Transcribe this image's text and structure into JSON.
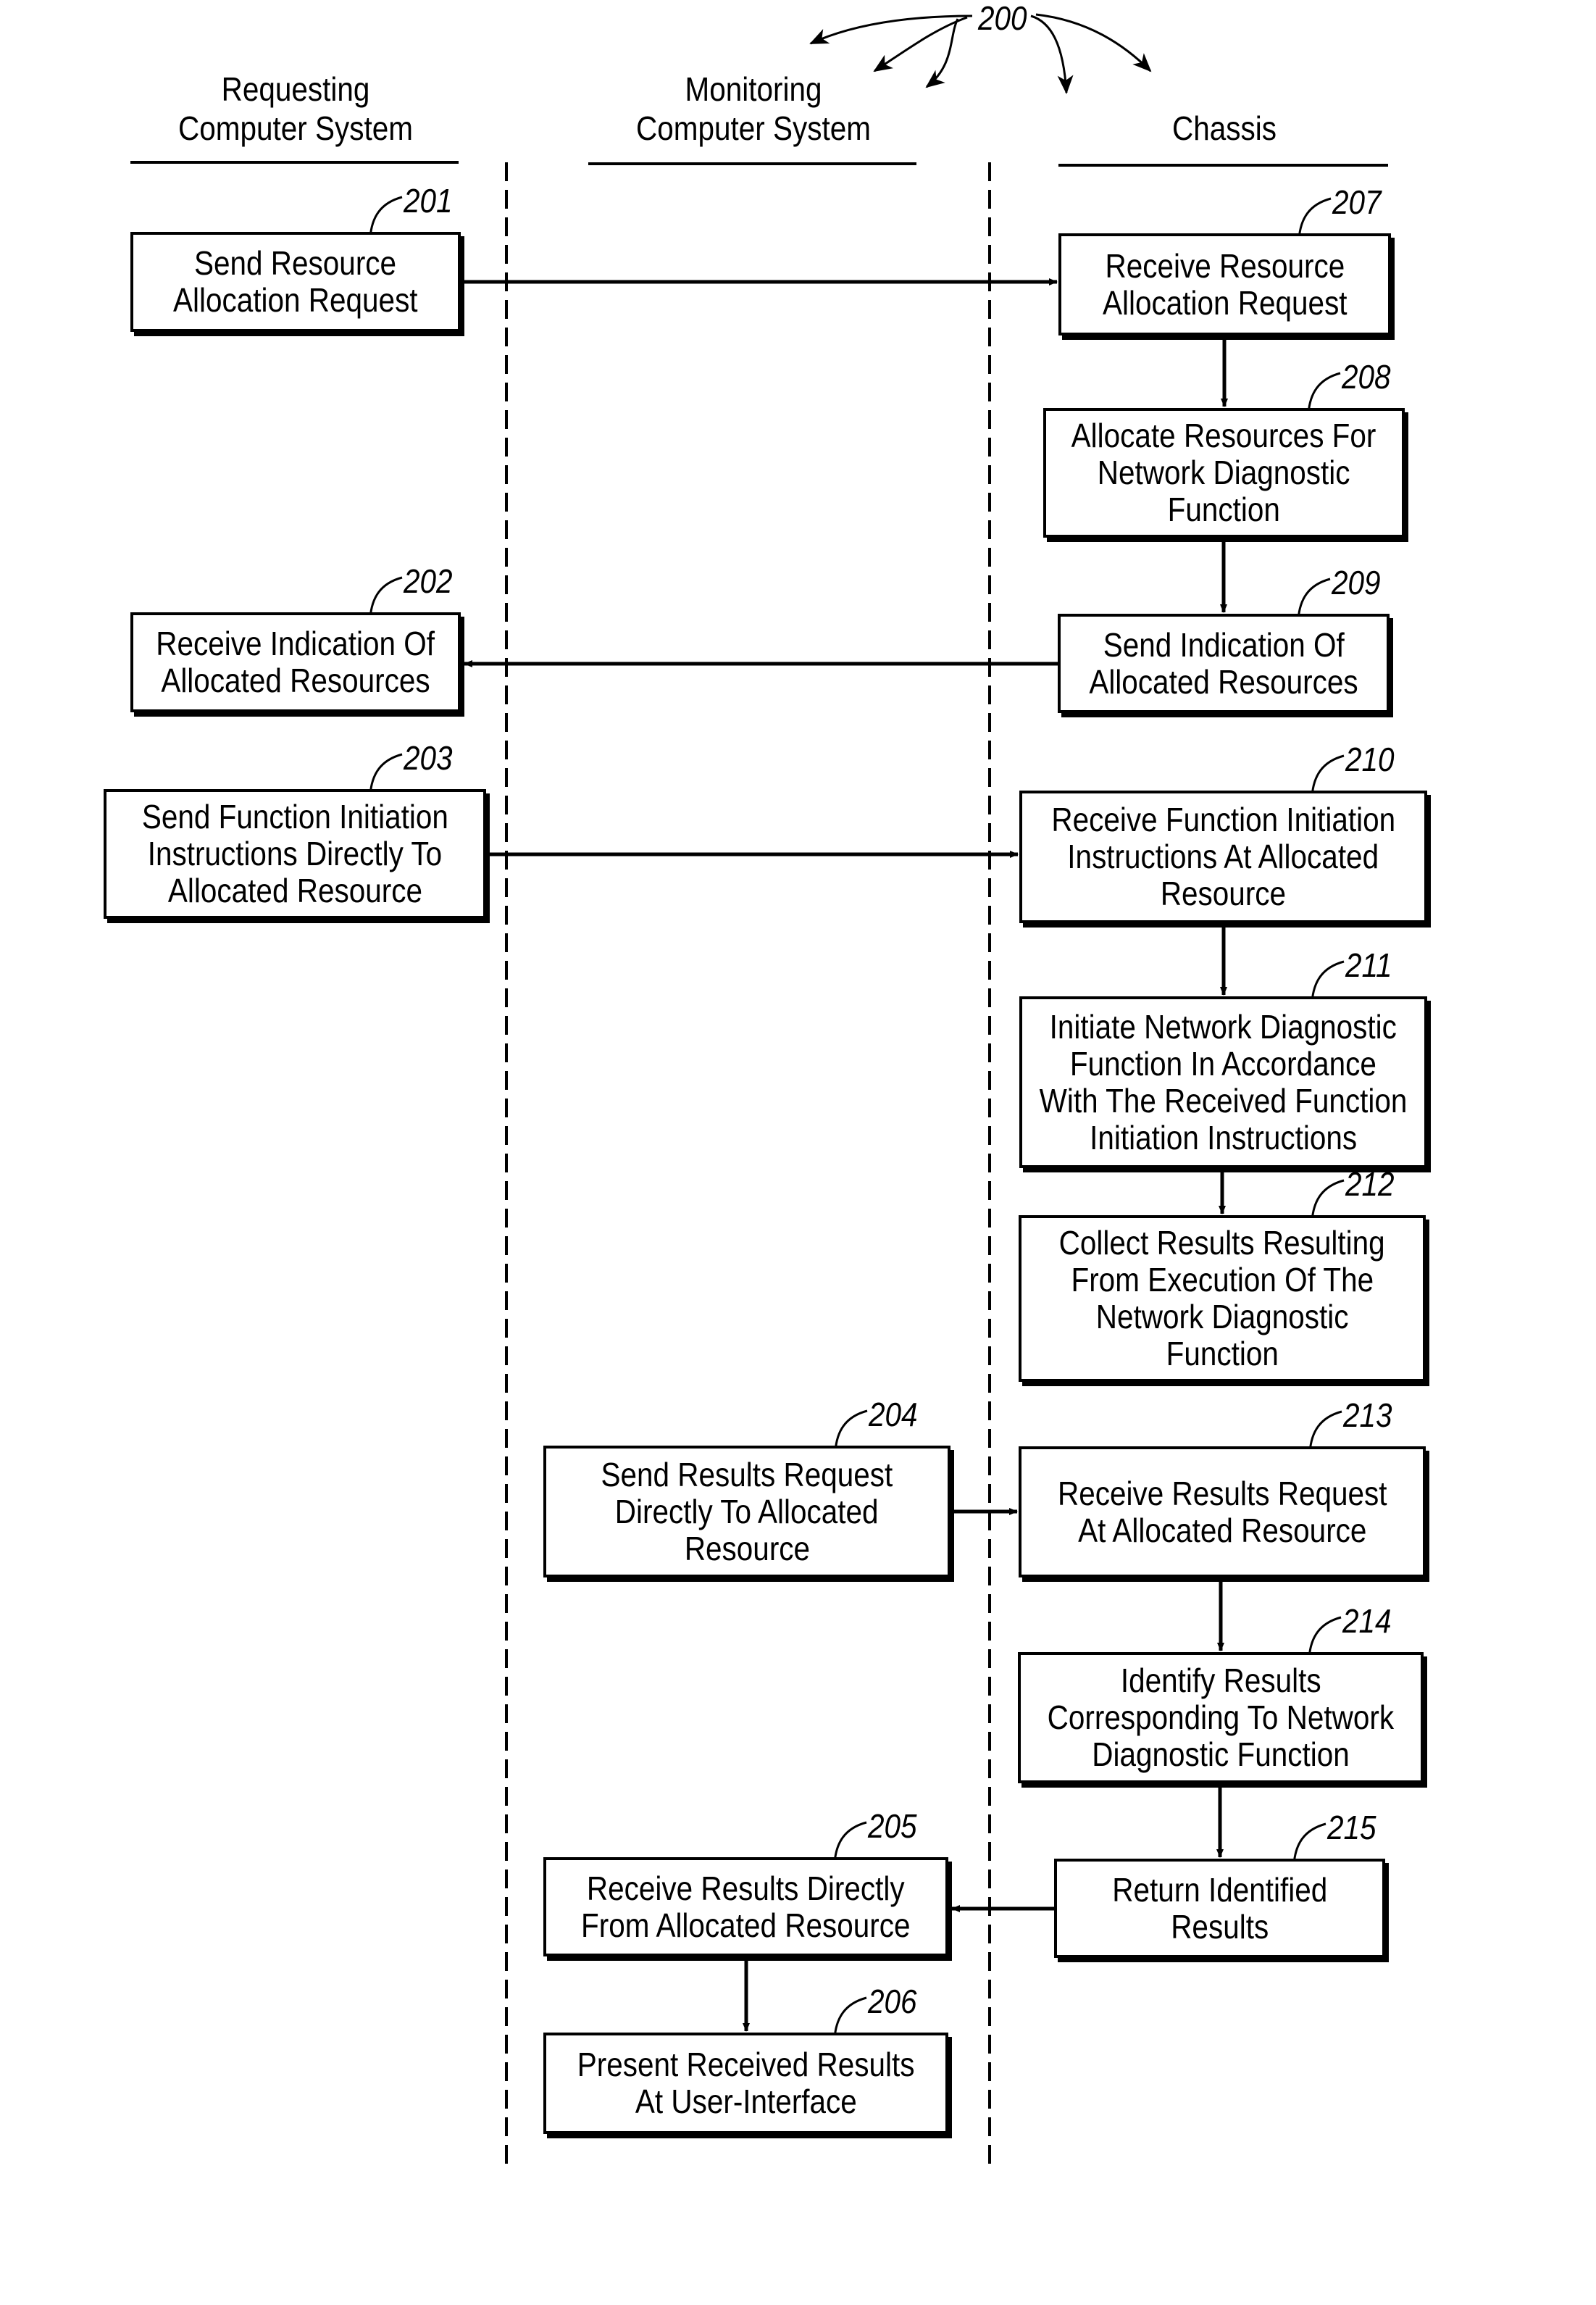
{
  "figure": {
    "reference": "200",
    "lanes": [
      {
        "id": "requesting",
        "title_lines": [
          "Requesting",
          "Computer System"
        ]
      },
      {
        "id": "monitoring",
        "title_lines": [
          "Monitoring",
          "Computer System"
        ]
      },
      {
        "id": "chassis",
        "title_lines": [
          "Chassis"
        ]
      }
    ],
    "steps": [
      {
        "ref": "201",
        "lane": "requesting",
        "lines": [
          "Send Resource",
          "Allocation Request"
        ]
      },
      {
        "ref": "202",
        "lane": "requesting",
        "lines": [
          "Receive Indication Of",
          "Allocated Resources"
        ]
      },
      {
        "ref": "203",
        "lane": "requesting",
        "lines": [
          "Send Function Initiation",
          "Instructions Directly To",
          "Allocated Resource"
        ]
      },
      {
        "ref": "204",
        "lane": "monitoring",
        "lines": [
          "Send Results Request",
          "Directly To Allocated",
          "Resource"
        ]
      },
      {
        "ref": "205",
        "lane": "monitoring",
        "lines": [
          "Receive Results Directly",
          "From Allocated Resource"
        ]
      },
      {
        "ref": "206",
        "lane": "monitoring",
        "lines": [
          "Present Received Results",
          "At User-Interface"
        ]
      },
      {
        "ref": "207",
        "lane": "chassis",
        "lines": [
          "Receive Resource",
          "Allocation Request"
        ]
      },
      {
        "ref": "208",
        "lane": "chassis",
        "lines": [
          "Allocate Resources For",
          "Network Diagnostic",
          "Function"
        ]
      },
      {
        "ref": "209",
        "lane": "chassis",
        "lines": [
          "Send Indication Of",
          "Allocated Resources"
        ]
      },
      {
        "ref": "210",
        "lane": "chassis",
        "lines": [
          "Receive Function Initiation",
          "Instructions At Allocated",
          "Resource"
        ]
      },
      {
        "ref": "211",
        "lane": "chassis",
        "lines": [
          "Initiate Network Diagnostic",
          "Function In Accordance",
          "With The Received Function",
          "Initiation Instructions"
        ]
      },
      {
        "ref": "212",
        "lane": "chassis",
        "lines": [
          "Collect Results Resulting",
          "From Execution Of The",
          "Network Diagnostic",
          "Function"
        ]
      },
      {
        "ref": "213",
        "lane": "chassis",
        "lines": [
          "Receive Results Request",
          "At Allocated Resource"
        ]
      },
      {
        "ref": "214",
        "lane": "chassis",
        "lines": [
          "Identify Results",
          "Corresponding To Network",
          "Diagnostic Function"
        ]
      },
      {
        "ref": "215",
        "lane": "chassis",
        "lines": [
          "Return Identified",
          "Results"
        ]
      }
    ],
    "flows": [
      {
        "from": "201",
        "to": "207",
        "direction": "right"
      },
      {
        "from": "207",
        "to": "208",
        "direction": "down"
      },
      {
        "from": "208",
        "to": "209",
        "direction": "down"
      },
      {
        "from": "209",
        "to": "202",
        "direction": "left"
      },
      {
        "from": "203",
        "to": "210",
        "direction": "right"
      },
      {
        "from": "210",
        "to": "211",
        "direction": "down"
      },
      {
        "from": "211",
        "to": "212",
        "direction": "down"
      },
      {
        "from": "204",
        "to": "213",
        "direction": "right"
      },
      {
        "from": "213",
        "to": "214",
        "direction": "down"
      },
      {
        "from": "214",
        "to": "215",
        "direction": "down"
      },
      {
        "from": "215",
        "to": "205",
        "direction": "left"
      },
      {
        "from": "205",
        "to": "206",
        "direction": "down"
      }
    ]
  }
}
